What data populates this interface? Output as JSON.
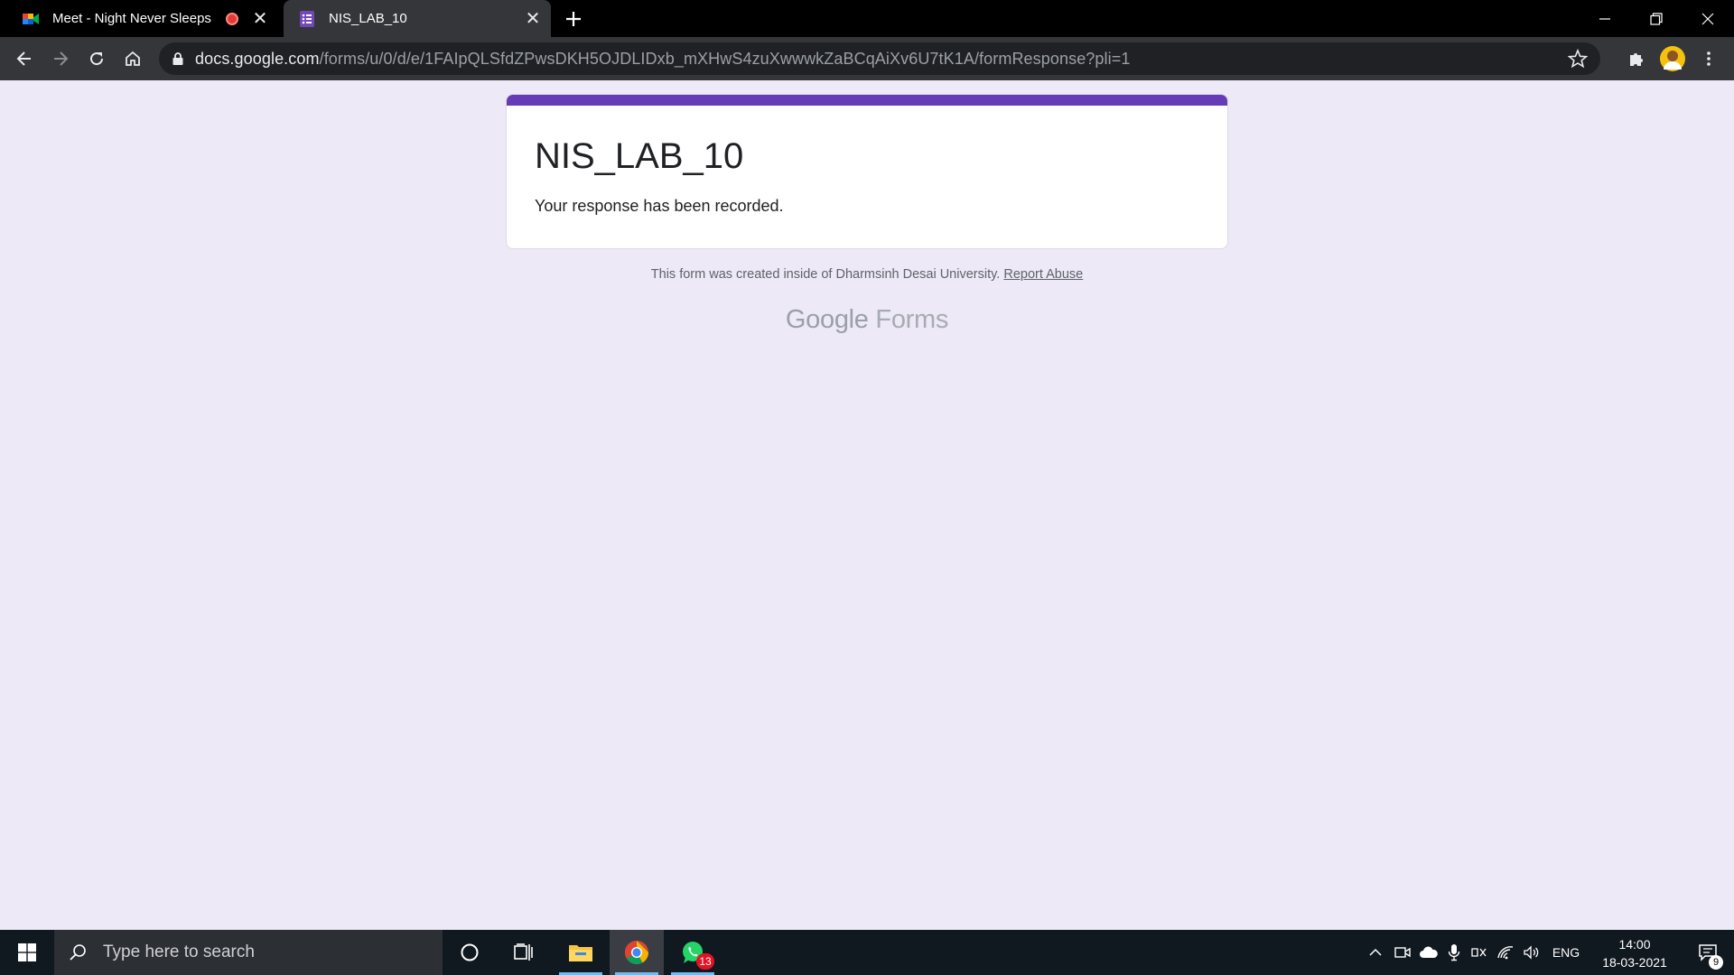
{
  "browser": {
    "tabs": [
      {
        "title": "Meet - Night Never Sleeps",
        "favicon": "google-meet-icon",
        "recording": true,
        "active": false
      },
      {
        "title": "NIS_LAB_10",
        "favicon": "google-forms-icon",
        "active": true
      }
    ],
    "url_host": "docs.google.com",
    "url_path": "/forms/u/0/d/e/1FAIpQLSfdZPwsDKH5OJDLIDxb_mXHwS4zuXwwwkZaBCqAiXv6U7tK1A/formResponse?pli=1"
  },
  "form": {
    "accent_color": "#673ab7",
    "title": "NIS_LAB_10",
    "confirmation": "Your response has been recorded.",
    "footer_text": "This form was created inside of Dharmsinh Desai University.",
    "report_abuse": "Report Abuse",
    "brand_google": "Google",
    "brand_forms": "Forms"
  },
  "taskbar": {
    "search_placeholder": "Type here to search",
    "whatsapp_badge": "13",
    "language": "ENG",
    "time": "14:00",
    "date": "18-03-2021",
    "notification_count": "9"
  }
}
